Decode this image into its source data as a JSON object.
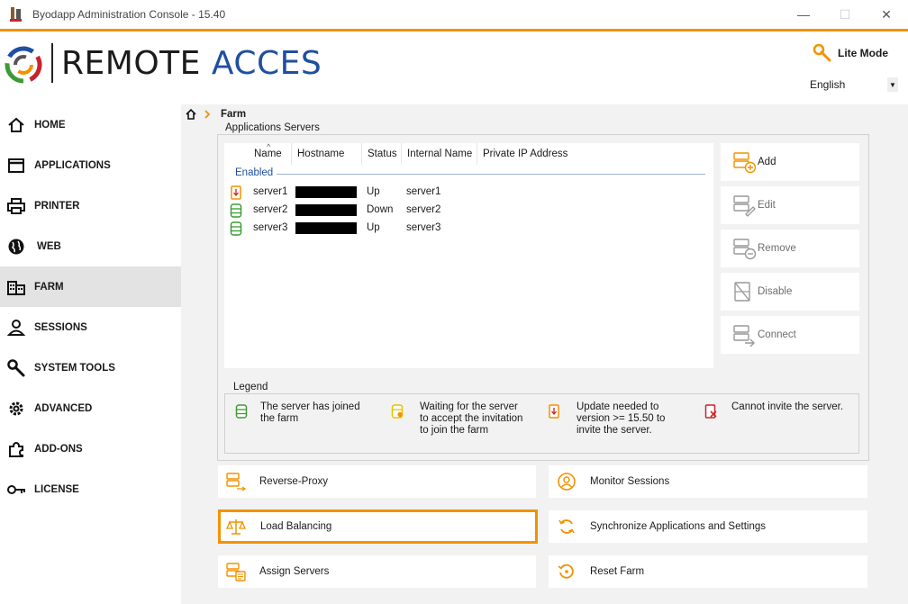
{
  "window": {
    "title": "Byodapp Administration Console - 15.40",
    "minimize": "—",
    "maximize": "☐",
    "close": "✕"
  },
  "header": {
    "logo_part1": "REMOTE",
    "logo_part2": "ACCES",
    "lite_mode_label": "Lite Mode",
    "language": "English"
  },
  "sidebar": {
    "items": [
      {
        "label": "HOME",
        "icon": "home-icon"
      },
      {
        "label": "APPLICATIONS",
        "icon": "window-icon"
      },
      {
        "label": "PRINTER",
        "icon": "printer-icon"
      },
      {
        "label": "WEB",
        "icon": "globe-icon"
      },
      {
        "label": "FARM",
        "icon": "building-icon",
        "active": true
      },
      {
        "label": "SESSIONS",
        "icon": "user-icon"
      },
      {
        "label": "SYSTEM TOOLS",
        "icon": "wrench-icon"
      },
      {
        "label": "ADVANCED",
        "icon": "gear-icon"
      },
      {
        "label": "ADD-ONS",
        "icon": "puzzle-icon"
      },
      {
        "label": "LICENSE",
        "icon": "key-icon"
      }
    ]
  },
  "breadcrumb": {
    "current": "Farm"
  },
  "app_servers": {
    "title": "Applications Servers",
    "columns": [
      "Name",
      "Hostname",
      "Status",
      "Internal Name",
      "Private IP Address"
    ],
    "group": "Enabled",
    "rows": [
      {
        "name": "server1",
        "status": "Up",
        "internal": "server1",
        "icon": "update-needed-icon"
      },
      {
        "name": "server2",
        "status": "Down",
        "internal": "server2",
        "icon": "server-joined-icon"
      },
      {
        "name": "server3",
        "status": "Up",
        "internal": "server3",
        "icon": "server-joined-icon"
      }
    ],
    "buttons": {
      "add": "Add",
      "edit": "Edit",
      "remove": "Remove",
      "disable": "Disable",
      "connect": "Connect"
    }
  },
  "legend": {
    "title": "Legend",
    "joined": [
      "The server has joined",
      "the farm"
    ],
    "waiting": [
      "Waiting for the server",
      "to accept the invitation",
      "to join the farm"
    ],
    "update": [
      "Update needed to",
      "version >= 15.50 to",
      "invite the server."
    ],
    "cannot": [
      "Cannot invite the server."
    ]
  },
  "tools": {
    "reverse_proxy": "Reverse-Proxy",
    "monitor_sessions": "Monitor Sessions",
    "load_balancing": "Load Balancing",
    "sync_apps": "Synchronize Applications and Settings",
    "assign_servers": "Assign Servers",
    "reset_farm": "Reset Farm"
  },
  "colors": {
    "accent": "#f39200",
    "brand_blue": "#1f4fa0",
    "ok_green": "#3d9b35",
    "error_red": "#c8232c"
  }
}
